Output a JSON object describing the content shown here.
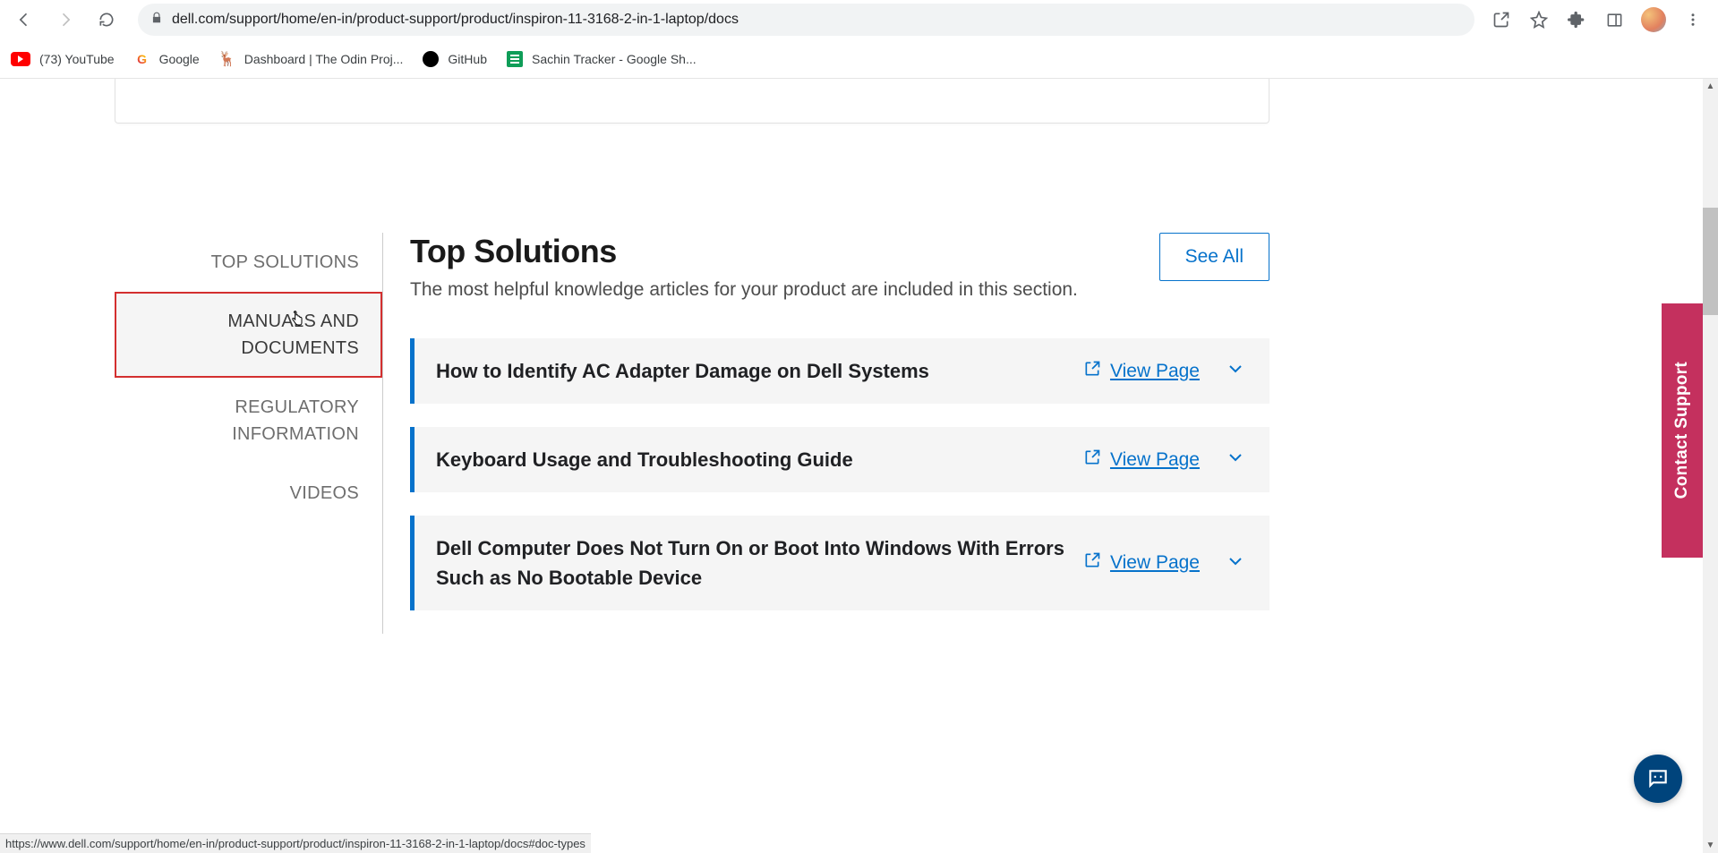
{
  "browser": {
    "url": "dell.com/support/home/en-in/product-support/product/inspiron-11-3168-2-in-1-laptop/docs",
    "bookmarks": [
      {
        "label": "(73) YouTube"
      },
      {
        "label": "Google"
      },
      {
        "label": "Dashboard | The Odin Proj..."
      },
      {
        "label": "GitHub"
      },
      {
        "label": "Sachin Tracker - Google Sh..."
      }
    ],
    "status_url": "https://www.dell.com/support/home/en-in/product-support/product/inspiron-11-3168-2-in-1-laptop/docs#doc-types"
  },
  "sidebar": {
    "items": [
      {
        "label": "TOP SOLUTIONS"
      },
      {
        "label": "MANUALS AND DOCUMENTS"
      },
      {
        "label": "REGULATORY INFORMATION"
      },
      {
        "label": "VIDEOS"
      }
    ]
  },
  "main": {
    "title": "Top Solutions",
    "subtitle": "The most helpful knowledge articles for your product are included in this section.",
    "see_all": "See All",
    "view_page_label": "View Page",
    "solutions": [
      {
        "title": "How to Identify AC Adapter Damage on Dell Systems"
      },
      {
        "title": "Keyboard Usage and Troubleshooting Guide"
      },
      {
        "title": "Dell Computer Does Not Turn On or Boot Into Windows With Errors Such as No Bootable Device"
      }
    ]
  },
  "contact_support": "Contact Support"
}
